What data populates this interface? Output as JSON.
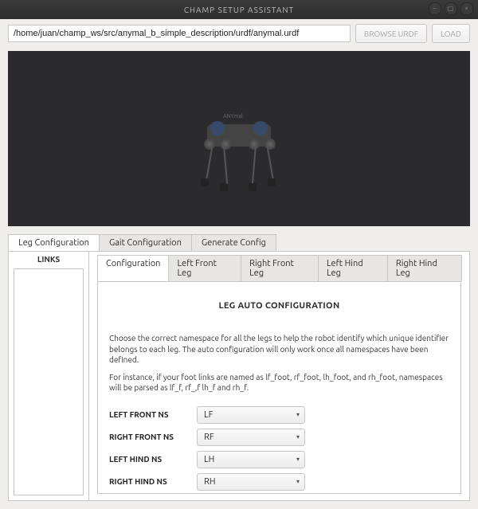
{
  "window": {
    "title": "CHAMP SETUP ASSISTANT"
  },
  "toolbar": {
    "path_value": "/home/juan/champ_ws/src/anymal_b_simple_description/urdf/anymal.urdf",
    "browse_label": "BROWSE URDF",
    "load_label": "LOAD"
  },
  "viewport": {
    "robot_badge": "ANYmal"
  },
  "outer_tabs": [
    {
      "id": "leg",
      "label": "Leg Configuration",
      "active": true
    },
    {
      "id": "gait",
      "label": "Gait Configuration",
      "active": false
    },
    {
      "id": "gen",
      "label": "Generate Config",
      "active": false
    }
  ],
  "links_header": "LINKS",
  "inner_tabs": [
    {
      "id": "cfg",
      "label": "Configuration",
      "active": true
    },
    {
      "id": "lf",
      "label": "Left Front Leg",
      "active": false
    },
    {
      "id": "rf",
      "label": "Right Front Leg",
      "active": false
    },
    {
      "id": "lh",
      "label": "Left Hind Leg",
      "active": false
    },
    {
      "id": "rh",
      "label": "Right Hind Leg",
      "active": false
    }
  ],
  "config": {
    "title": "LEG AUTO CONFIGURATION",
    "help1": "Choose the correct namespace for all the legs to help the robot identify which unique identifier belongs to each leg. The auto configuration will only work once all namespaces have been defined.",
    "help2": "For instance, if your foot links are named as lf_foot, rf_foot, lh_foot, and rh_foot, namespaces will be parsed as lf_f, rf_,f lh_f and rh_f.",
    "fields": {
      "lf": {
        "label": "LEFT FRONT NS",
        "value": "LF"
      },
      "rf": {
        "label": "RIGHT FRONT NS",
        "value": "RF"
      },
      "lh": {
        "label": "LEFT HIND NS",
        "value": "LH"
      },
      "rh": {
        "label": "RIGHT HIND NS",
        "value": "RH"
      }
    }
  }
}
